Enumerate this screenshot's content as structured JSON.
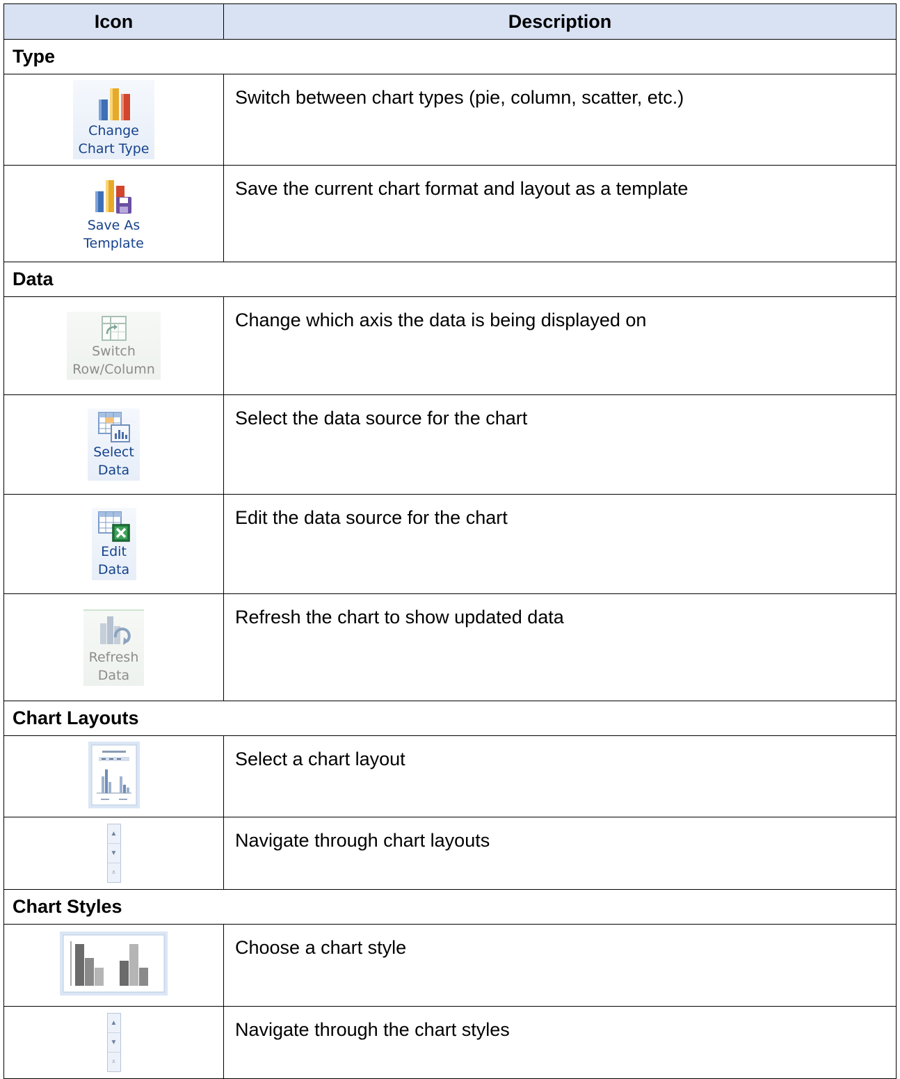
{
  "table": {
    "headers": {
      "icon": "Icon",
      "description": "Description"
    },
    "sections": [
      {
        "title": "Type",
        "rows": [
          {
            "icon": "change-chart-type-icon",
            "label_lines": [
              "Change",
              "Chart Type"
            ],
            "description": "Switch between chart types (pie, column, scatter, etc.)"
          },
          {
            "icon": "save-as-template-icon",
            "label_lines": [
              "Save As",
              "Template"
            ],
            "description": "Save the current chart format and layout as a template"
          }
        ]
      },
      {
        "title": "Data",
        "rows": [
          {
            "icon": "switch-row-column-icon",
            "label_lines": [
              "Switch",
              "Row/Column"
            ],
            "description": "Change which axis the data is being displayed on"
          },
          {
            "icon": "select-data-icon",
            "label_lines": [
              "Select",
              "Data"
            ],
            "description": "Select the data source for the chart"
          },
          {
            "icon": "edit-data-icon",
            "label_lines": [
              "Edit",
              "Data"
            ],
            "description": "Edit the data source for the chart"
          },
          {
            "icon": "refresh-data-icon",
            "label_lines": [
              "Refresh",
              "Data"
            ],
            "description": "Refresh the chart to show updated data"
          }
        ]
      },
      {
        "title": "Chart Layouts",
        "rows": [
          {
            "icon": "chart-layout-thumbnail-icon",
            "description": "Select a chart layout"
          },
          {
            "icon": "gallery-scroll-icon",
            "description": "Navigate through chart layouts"
          }
        ]
      },
      {
        "title": "Chart Styles",
        "rows": [
          {
            "icon": "chart-style-thumbnail-icon",
            "description": "Choose a chart style"
          },
          {
            "icon": "gallery-scroll-icon",
            "description": "Navigate through the chart styles"
          }
        ]
      }
    ]
  },
  "scroll_arrows": {
    "up": "▲",
    "down": "▼",
    "more": "⩡"
  },
  "colors": {
    "header_bg": "#d9e2f3",
    "ribbon_label": "#15428b",
    "disabled_label": "#8c8c8c"
  }
}
